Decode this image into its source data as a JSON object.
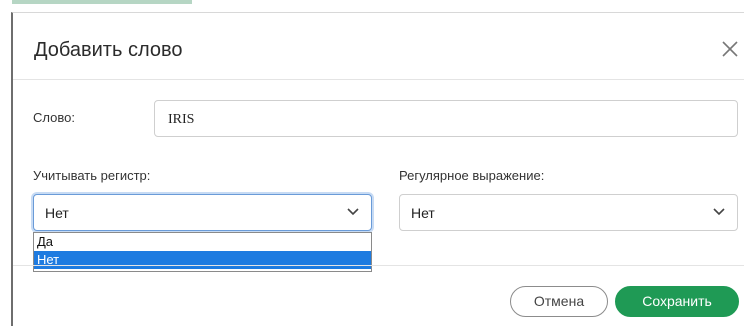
{
  "dialog": {
    "title": "Добавить слово",
    "close_icon": "close-icon"
  },
  "word": {
    "label": "Слово:",
    "value": "IRIS"
  },
  "case_sensitive": {
    "label": "Учитывать регистр:",
    "value": "Нет",
    "options": [
      "Да",
      "Нет"
    ],
    "selected_option": "Нет"
  },
  "regex": {
    "label": "Регулярное выражение:",
    "value": "Нет"
  },
  "buttons": {
    "cancel": "Отмена",
    "save": "Сохранить"
  },
  "colors": {
    "primary": "#1f9a55",
    "selection": "#1e7be0",
    "focus": "#6a9bd8"
  }
}
